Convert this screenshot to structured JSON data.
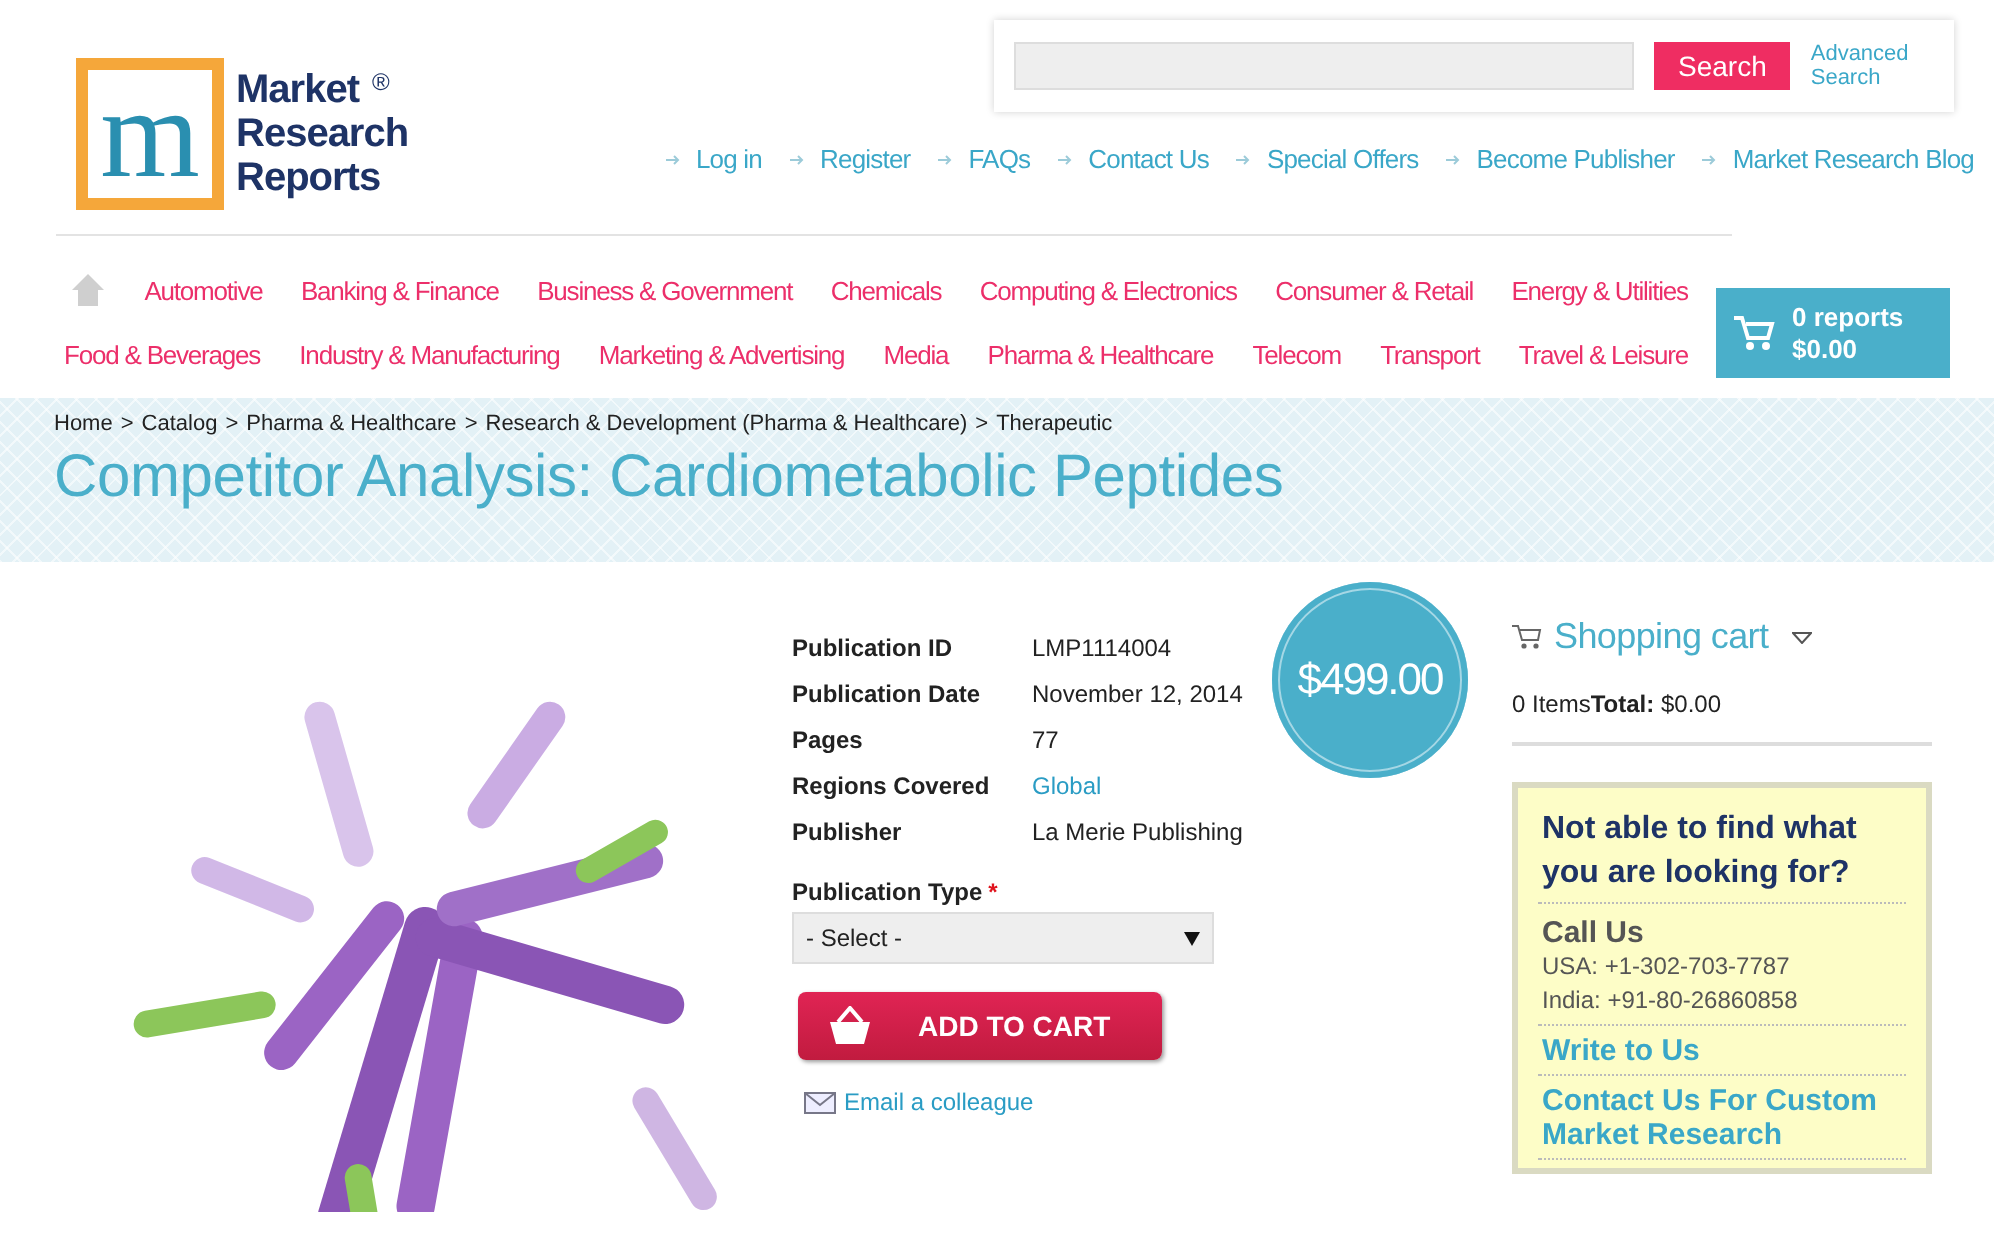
{
  "logo": {
    "letter": "m",
    "lines": [
      "Market",
      "Research",
      "Reports"
    ],
    "mark": "®"
  },
  "search": {
    "button": "Search",
    "advanced": "Advanced Search"
  },
  "top_links": [
    "Log in",
    "Register",
    "FAQs",
    "Contact Us",
    "Special Offers",
    "Become Publisher",
    "Market Research Blog"
  ],
  "category_rows": [
    [
      "Automotive",
      "Banking & Finance",
      "Business & Government",
      "Chemicals",
      "Computing & Electronics",
      "Consumer & Retail",
      "Energy & Utilities"
    ],
    [
      "Food & Beverages",
      "Industry & Manufacturing",
      "Marketing & Advertising",
      "Media",
      "Pharma & Healthcare",
      "Telecom",
      "Transport",
      "Travel & Leisure"
    ]
  ],
  "mini_cart": {
    "count": "0 reports",
    "total": "$0.00"
  },
  "breadcrumb": {
    "separator": ">",
    "items": [
      "Home",
      "Catalog",
      "Pharma & Healthcare",
      "Research & Development (Pharma & Healthcare)",
      "Therapeutic"
    ]
  },
  "title": "Competitor Analysis: Cardiometabolic Peptides",
  "details": [
    {
      "label": "Publication ID",
      "value": "LMP1114004",
      "kind": "text"
    },
    {
      "label": "Publication Date",
      "value": "November 12, 2014",
      "kind": "text"
    },
    {
      "label": "Pages",
      "value": "77",
      "kind": "text"
    },
    {
      "label": "Regions Covered",
      "value": "Global",
      "kind": "link"
    },
    {
      "label": "Publisher",
      "value": "La Merie Publishing",
      "kind": "text"
    }
  ],
  "price": "$499.00",
  "publication_type": {
    "label": "Publication Type",
    "required_mark": "*",
    "value": "- Select -"
  },
  "add_to_cart": "ADD TO CART",
  "email_link": "Email a colleague",
  "shopping_cart": {
    "title": "Shopping cart",
    "items": "0 Items",
    "total_label": "Total:",
    "total": "$0.00"
  },
  "help_box": {
    "heading": "Not able to find what you are looking for?",
    "call_title": "Call Us",
    "phones": [
      "USA: +1-302-703-7787",
      "India: +91-80-26860858"
    ],
    "links": [
      "Write to Us",
      "Contact Us For Custom Market Research"
    ]
  }
}
